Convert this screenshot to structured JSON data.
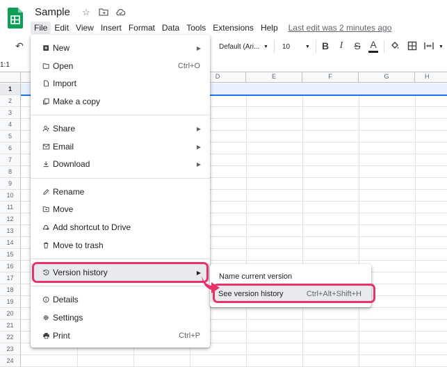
{
  "doc": {
    "title": "Sample"
  },
  "menubar": {
    "items": [
      "File",
      "Edit",
      "View",
      "Insert",
      "Format",
      "Data",
      "Tools",
      "Extensions",
      "Help"
    ],
    "last_edit": "Last edit was 2 minutes ago"
  },
  "toolbar": {
    "font": "Default (Ari...",
    "font_size": "10"
  },
  "grid": {
    "cell_ref": "1:1",
    "columns": [
      "D",
      "E",
      "F",
      "G",
      "H"
    ],
    "rows": [
      "1",
      "2",
      "3",
      "4",
      "5",
      "6",
      "7",
      "8",
      "9",
      "10",
      "11",
      "12",
      "13",
      "14",
      "15",
      "16",
      "17",
      "18",
      "19",
      "20",
      "21",
      "22",
      "23",
      "24"
    ]
  },
  "file_menu": {
    "items": [
      {
        "label": "New",
        "icon": "plus-square-icon"
      },
      {
        "label": "Open",
        "shortcut": "Ctrl+O",
        "icon": "folder-icon"
      },
      {
        "label": "Import",
        "icon": "file-icon"
      },
      {
        "label": "Make a copy",
        "icon": "copy-icon"
      },
      {
        "label": "Share",
        "icon": "person-add-icon"
      },
      {
        "label": "Email",
        "icon": "mail-icon"
      },
      {
        "label": "Download",
        "icon": "download-icon"
      },
      {
        "label": "Rename",
        "icon": "pencil-icon"
      },
      {
        "label": "Move",
        "icon": "folder-move-icon"
      },
      {
        "label": "Add shortcut to Drive",
        "icon": "drive-shortcut-icon"
      },
      {
        "label": "Move to trash",
        "icon": "trash-icon"
      },
      {
        "label": "Version history",
        "icon": "history-icon"
      },
      {
        "label": "Details",
        "icon": "info-icon"
      },
      {
        "label": "Settings",
        "icon": "gear-icon"
      },
      {
        "label": "Print",
        "shortcut": "Ctrl+P",
        "icon": "printer-icon"
      }
    ]
  },
  "version_submenu": {
    "items": [
      {
        "label": "Name current version"
      },
      {
        "label": "See version history",
        "shortcut": "Ctrl+Alt+Shift+H"
      }
    ]
  },
  "colors": {
    "highlight": "#e8326a",
    "sheets_green": "#0f9d58",
    "selection_blue": "#1a73e8"
  }
}
